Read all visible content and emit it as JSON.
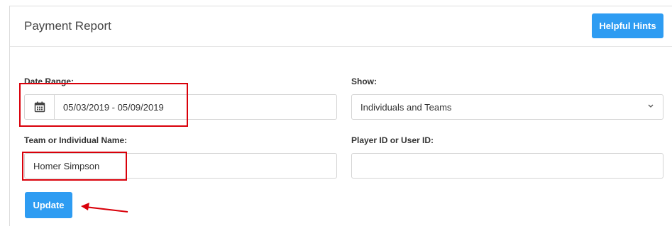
{
  "header": {
    "title": "Payment Report",
    "helpful_hints_label": "Helpful Hints"
  },
  "form": {
    "date_range": {
      "label": "Date Range:",
      "value": "05/03/2019 - 05/09/2019",
      "icon": "calendar-icon"
    },
    "show": {
      "label": "Show:",
      "selected": "Individuals and Teams",
      "icon": "chevron-down-icon"
    },
    "name": {
      "label": "Team or Individual Name:",
      "value": "Homer Simpson"
    },
    "player_id": {
      "label": "Player ID or User ID:",
      "value": ""
    },
    "update_label": "Update"
  },
  "colors": {
    "primary_button": "#2e9cf2",
    "annotation": "#d9000a"
  }
}
